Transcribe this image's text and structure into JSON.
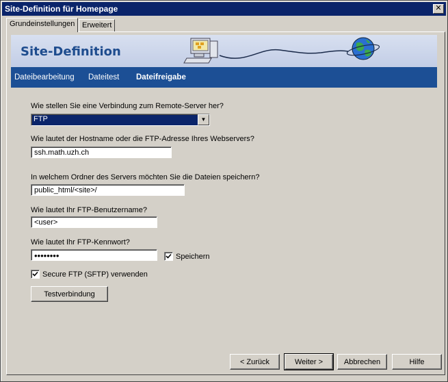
{
  "window": {
    "title": "Site-Definition für Homepage",
    "close_symbol": "✕"
  },
  "tabs": [
    {
      "label": "Grundeinstellungen",
      "active": true
    },
    {
      "label": "Erweitert",
      "active": false
    }
  ],
  "banner": {
    "title": "Site-Definition",
    "icons": [
      "computer-icon",
      "globe-icon"
    ]
  },
  "nav": {
    "items": [
      {
        "label": "Dateibearbeitung",
        "active": false
      },
      {
        "label": "Dateitest",
        "active": false
      },
      {
        "label": "Dateifreigabe",
        "active": true
      }
    ]
  },
  "form": {
    "connection_label": "Wie stellen Sie eine Verbindung zum Remote-Server her?",
    "connection_value": "FTP",
    "hostname_label": "Wie lautet der Hostname oder die FTP-Adresse Ihres Webservers?",
    "hostname_value": "ssh.math.uzh.ch",
    "folder_label": "In welchem Ordner des Servers möchten Sie die Dateien speichern?",
    "folder_value": "public_html/<site>/",
    "username_label": "Wie lautet Ihr FTP-Benutzername?",
    "username_value": "<user>",
    "password_label": "Wie lautet Ihr FTP-Kennwort?",
    "password_value": "••••••••",
    "save_label": "Speichern",
    "save_checked": true,
    "sftp_label": "Secure FTP (SFTP) verwenden",
    "sftp_checked": true,
    "test_button": "Testverbindung"
  },
  "footer": {
    "back_button": "< Zurück",
    "next_button": "Weiter >",
    "cancel_button": "Abbrechen",
    "help_button": "Hilfe"
  },
  "colors": {
    "title_bar": "#0a246a",
    "banner_bg": "#c9d3ea",
    "nav_bg": "#1c4f95",
    "banner_title": "#1e4c8e"
  }
}
